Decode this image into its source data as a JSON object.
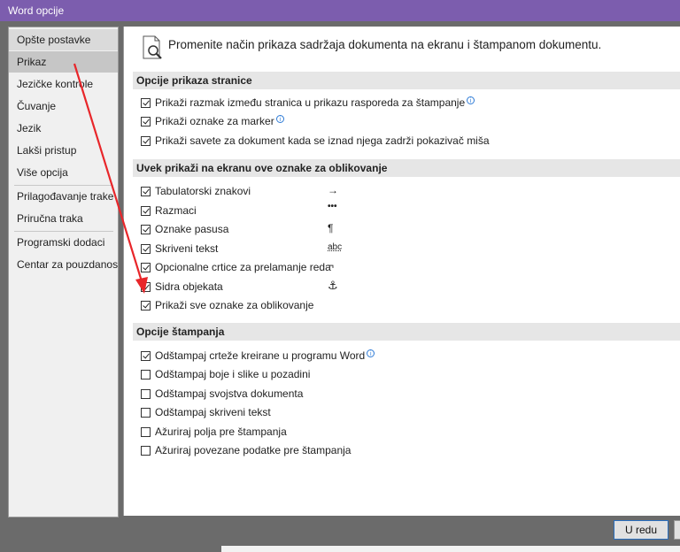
{
  "window": {
    "title": "Word opcije"
  },
  "sidebar": {
    "items": [
      {
        "label": "Opšte postavke"
      },
      {
        "label": "Prikaz"
      },
      {
        "label": "Jezičke kontrole"
      },
      {
        "label": "Čuvanje"
      },
      {
        "label": "Jezik"
      },
      {
        "label": "Lakši pristup"
      },
      {
        "label": "Više opcija"
      },
      {
        "label": "Prilagođavanje trake"
      },
      {
        "label": "Priručna traka"
      },
      {
        "label": "Programski dodaci"
      },
      {
        "label": "Centar za pouzdanost"
      }
    ],
    "selected": "Prikaz"
  },
  "main": {
    "header": "Promenite način prikaza sadržaja dokumenta na ekranu i štampanom dokumentu.",
    "sections": [
      {
        "title": "Opcije prikaza stranice",
        "options": [
          {
            "label": "Prikaži razmak između stranica u prikazu rasporeda za štampanje",
            "checked": true,
            "info": true
          },
          {
            "label": "Prikaži oznake za marker",
            "checked": true,
            "info": true
          },
          {
            "label": "Prikaži savete za dokument kada se iznad njega zadrži pokazivač miša",
            "checked": true,
            "info": false
          }
        ]
      },
      {
        "title": "Uvek prikaži na ekranu ove oznake za oblikovanje",
        "options": [
          {
            "label": "Tabulatorski znakovi",
            "checked": true,
            "symbol": "→"
          },
          {
            "label": "Razmaci",
            "checked": true,
            "symbol": "•••"
          },
          {
            "label": "Oznake pasusa",
            "checked": true,
            "symbol": "¶"
          },
          {
            "label": "Skriveni tekst",
            "checked": true,
            "symbol": "abc"
          },
          {
            "label": "Opcionalne crtice za prelamanje reda",
            "checked": true,
            "symbol": "¬"
          },
          {
            "label": "Sidra objekata",
            "checked": true,
            "symbol": "⚓"
          },
          {
            "label": "Prikaži sve oznake za oblikovanje",
            "checked": true
          }
        ]
      },
      {
        "title": "Opcije štampanja",
        "options": [
          {
            "label": "Odštampaj crteže kreirane u programu Word",
            "checked": true,
            "info": true
          },
          {
            "label": "Odštampaj boje i slike u pozadini",
            "checked": false
          },
          {
            "label": "Odštampaj svojstva dokumenta",
            "checked": false
          },
          {
            "label": "Odštampaj skriveni tekst",
            "checked": false
          },
          {
            "label": "Ažuriraj polja pre štampanja",
            "checked": false
          },
          {
            "label": "Ažuriraj povezane podatke pre štampanja",
            "checked": false
          }
        ]
      }
    ]
  },
  "footer": {
    "ok_label": "U redu"
  },
  "colors": {
    "titlebar": "#7c5dae",
    "arrow": "#e8262a",
    "info": "#2e7bd6"
  },
  "icons": {
    "header_icon": "magnifier-page-icon",
    "info_icon": "info-icon"
  }
}
